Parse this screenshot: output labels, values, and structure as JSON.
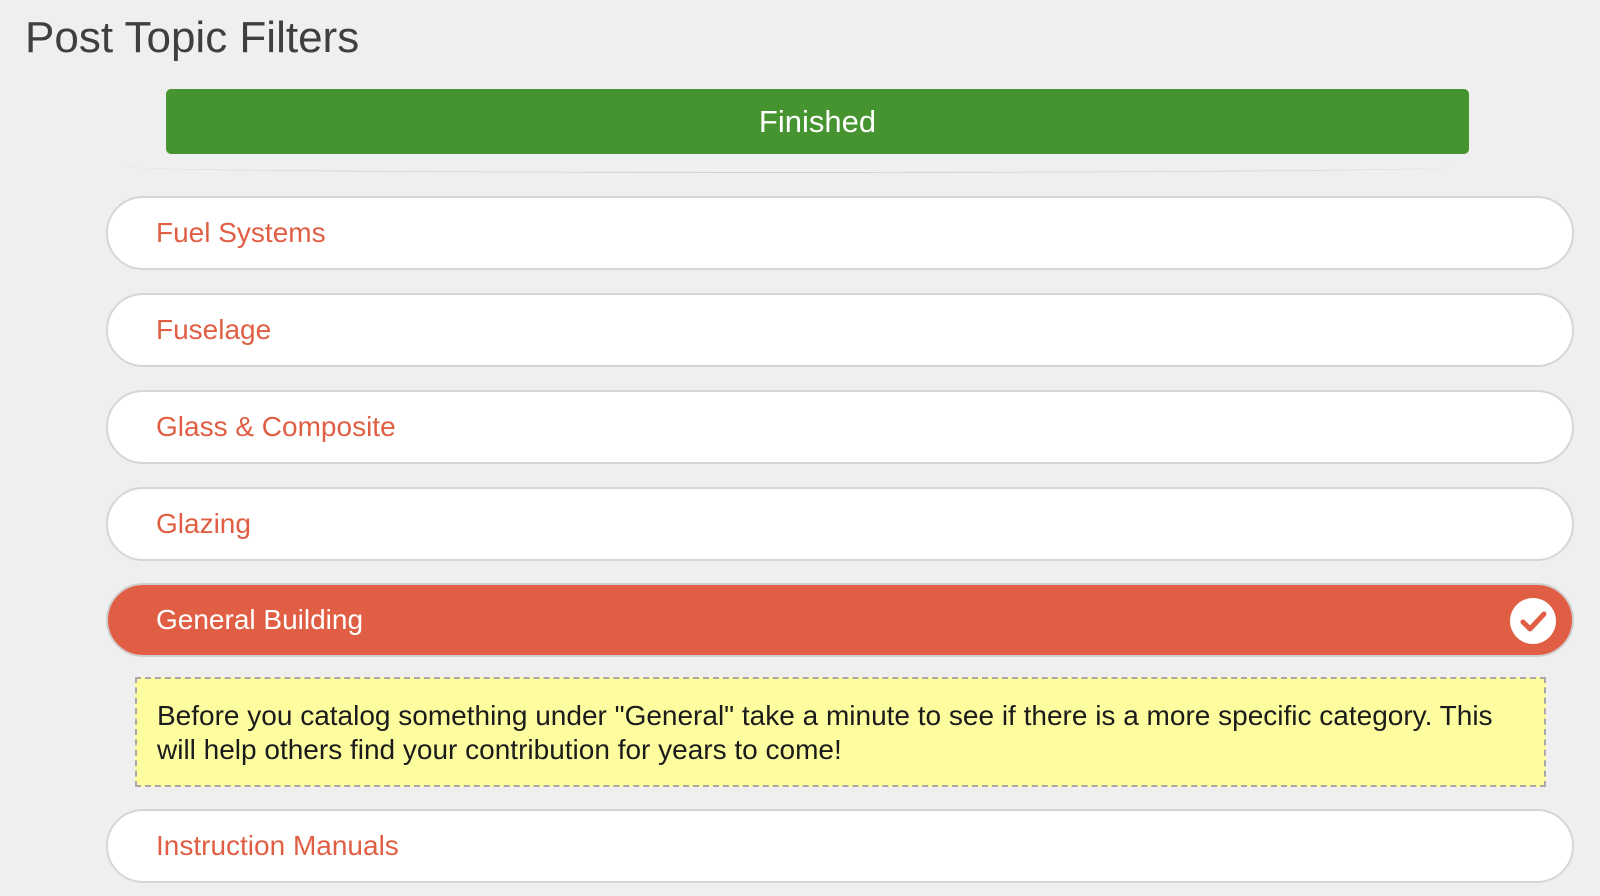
{
  "header": {
    "title": "Post Topic Filters"
  },
  "finished_button": {
    "label": "Finished",
    "color": "#46942f"
  },
  "filters": [
    {
      "label": "Fuel Systems",
      "selected": false
    },
    {
      "label": "Fuselage",
      "selected": false
    },
    {
      "label": "Glass & Composite",
      "selected": false
    },
    {
      "label": "Glazing",
      "selected": false
    },
    {
      "label": "General Building",
      "selected": true,
      "icon": "check-circle-icon"
    },
    {
      "label": "Instruction Manuals",
      "selected": false
    }
  ],
  "general_note": {
    "text": "Before you catalog something under \"General\" take a minute to see if there is a more specific category. This will help others find your contribution for years to come!",
    "background": "#fdfda0"
  },
  "colors": {
    "accent": "#e05f44",
    "unselected_text": "#e05f44",
    "selected_text": "#ffffff",
    "page_background": "#efefef"
  }
}
